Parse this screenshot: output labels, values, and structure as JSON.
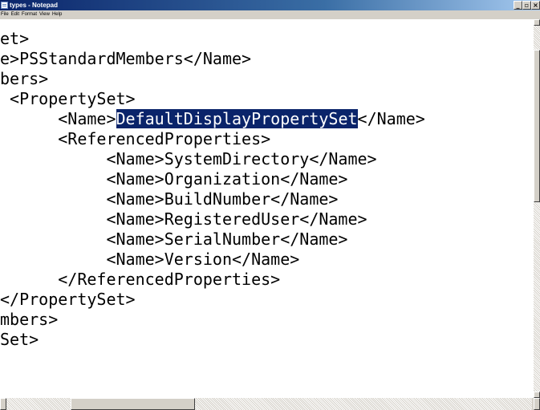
{
  "window": {
    "title": "types - Notepad",
    "minimize_glyph": "_",
    "maximize_glyph": "▫",
    "close_glyph": "×"
  },
  "menu": [
    "File",
    "Edit",
    "Format",
    "View",
    "Help"
  ],
  "editor": {
    "lines": [
      {
        "text": "et>"
      },
      {
        "text": "e>PSStandardMembers</Name>"
      },
      {
        "text": "bers>"
      },
      {
        "text": " <PropertySet>"
      },
      {
        "pre": "      <Name>",
        "sel": "DefaultDisplayPropertySet",
        "post": "</Name>"
      },
      {
        "text": "      <ReferencedProperties>"
      },
      {
        "text": "           <Name>SystemDirectory</Name>"
      },
      {
        "text": "           <Name>Organization</Name>"
      },
      {
        "text": "           <Name>BuildNumber</Name>"
      },
      {
        "text": "           <Name>RegisteredUser</Name>"
      },
      {
        "text": "           <Name>SerialNumber</Name>"
      },
      {
        "text": "           <Name>Version</Name>"
      },
      {
        "text": "      </ReferencedProperties>"
      },
      {
        "text": "</PropertySet>"
      },
      {
        "text": "mbers>"
      },
      {
        "text": "Set>"
      }
    ]
  },
  "colors": {
    "selection_bg": "#0a246a",
    "selection_fg": "#ffffff",
    "chrome": "#d4d0c8"
  }
}
